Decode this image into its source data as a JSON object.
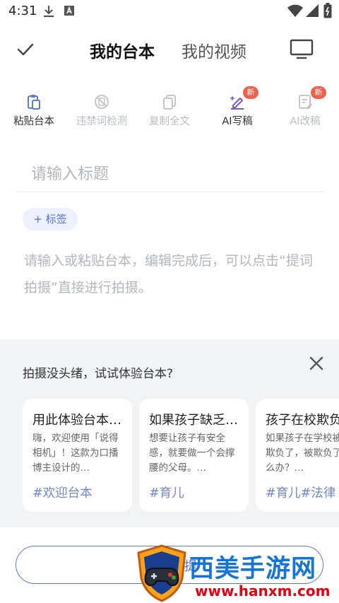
{
  "status_bar": {
    "time": "4:31",
    "icons": [
      "download-icon",
      "a-letter-icon",
      "wifi-icon",
      "signal-icon",
      "battery-icon"
    ]
  },
  "header": {
    "tabs": [
      {
        "label": "我的台本",
        "active": true
      },
      {
        "label": "我的视频",
        "active": false
      }
    ],
    "left_icon": "check-icon",
    "right_icon": "monitor-icon"
  },
  "toolbar": {
    "items": [
      {
        "label": "粘贴台本",
        "icon": "paste-icon",
        "enabled": true,
        "badge": ""
      },
      {
        "label": "违禁词检测",
        "icon": "forbidden-word-icon",
        "enabled": false,
        "badge": ""
      },
      {
        "label": "复制全文",
        "icon": "copy-icon",
        "enabled": false,
        "badge": ""
      },
      {
        "label": "AI写稿",
        "icon": "ai-write-icon",
        "enabled": true,
        "badge": "新"
      },
      {
        "label": "AI改稿",
        "icon": "ai-rewrite-icon",
        "enabled": false,
        "badge": "新"
      }
    ]
  },
  "editor": {
    "title_placeholder": "请输入标题",
    "tag_button": "+ 标签",
    "body_placeholder": "请输入或粘贴台本，编辑完成后，可以点击“提词拍摄”直接进行拍摄。"
  },
  "suggestions": {
    "title": "拍摄没头绪，试试体验台本?",
    "cards": [
      {
        "title": "用此体验台本…",
        "desc": "嗨，欢迎使用「说得相机」！这款为口播博主设计的…",
        "tags": "#欢迎台本"
      },
      {
        "title": "如果孩子缺乏…",
        "desc": "想要让孩子有安全感，就要做一个会撑腰的父母。…",
        "tags": "#育儿"
      },
      {
        "title": "孩子在校欺负",
        "desc": "如果孩子在学校被人欺负了，被欺负了怎么办？…",
        "tags": "#育儿#法律"
      }
    ]
  },
  "bottom": {
    "record_label": "提"
  },
  "watermark": {
    "title": "西美手游网",
    "url": "www.hanxm.com"
  },
  "colors": {
    "accent": "#5470d0",
    "badge": "#f0614c",
    "disabled": "#b8bcc4",
    "tag_text": "#6f86cf",
    "panel_bg": "#f2f3f5"
  }
}
